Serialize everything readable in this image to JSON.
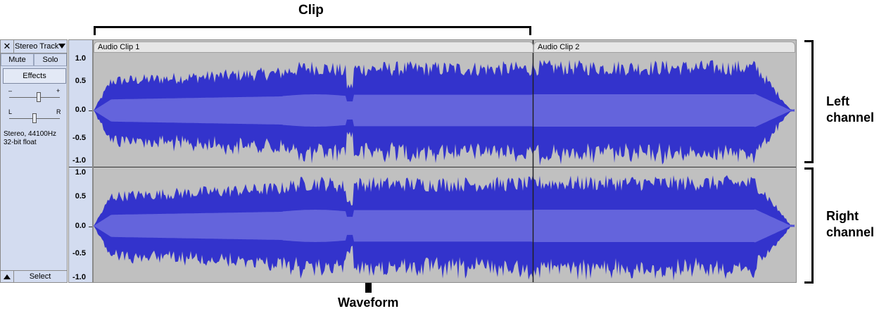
{
  "annotations": {
    "clip": "Clip",
    "left_channel": "Left\nchannel",
    "right_channel": "Right\nchannel",
    "waveform": "Waveform"
  },
  "track_panel": {
    "close_symbol": "✕",
    "track_name": "Stereo Track",
    "mute_label": "Mute",
    "solo_label": "Solo",
    "effects_label": "Effects",
    "gain_minus": "–",
    "gain_plus": "+",
    "pan_left": "L",
    "pan_right": "R",
    "info_line1": "Stereo, 44100Hz",
    "info_line2": "32-bit float",
    "select_label": "Select"
  },
  "ruler": {
    "left_ticks": [
      "1.0",
      "0.5",
      "0.0",
      "-0.5",
      "-1.0"
    ],
    "right_ticks": [
      "1.0",
      "0.5",
      "0.0",
      "-0.5",
      "-1.0"
    ]
  },
  "clips": [
    {
      "name": "Audio Clip 1"
    },
    {
      "name": "Audio Clip 2"
    }
  ],
  "colors": {
    "waveform_peak": "#3333cc",
    "waveform_rms": "#6464dc",
    "track_background": "#c0c0c0",
    "panel_background": "#d3dcf0"
  },
  "icons": {
    "collapse": "triangle-up-icon",
    "dropdown": "triangle-down-icon",
    "close": "close-icon",
    "arrow": "arrow-up-icon"
  }
}
